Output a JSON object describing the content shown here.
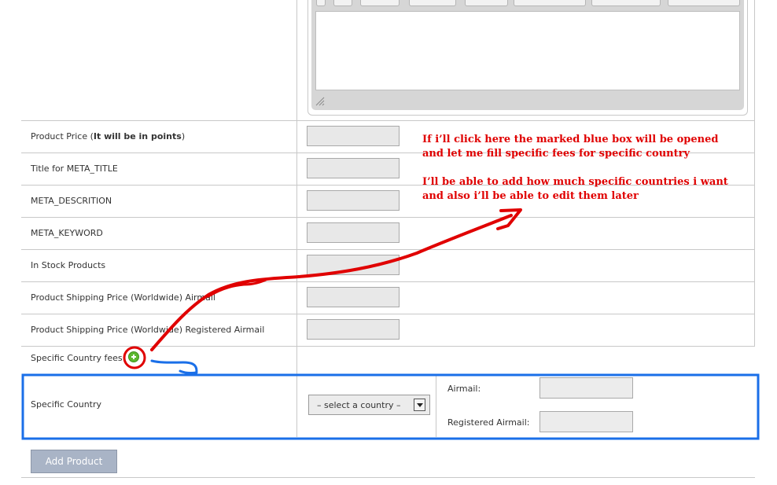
{
  "form": {
    "rows": [
      {
        "id": "price",
        "label_prefix": "Product Price (",
        "label_bold": "It will be in points",
        "label_suffix": ")"
      },
      {
        "id": "meta_title",
        "label": "Title for META_TITLE"
      },
      {
        "id": "meta_desc",
        "label": "META_DESCRITION"
      },
      {
        "id": "meta_keyword",
        "label": "META_KEYWORD"
      },
      {
        "id": "stock",
        "label": "In Stock Products"
      },
      {
        "id": "ship_airmail",
        "label": "Product Shipping Price (Worldwide) Airmail"
      },
      {
        "id": "ship_registered",
        "label": "Product Shipping Price (Worldwide) Registered Airmail"
      },
      {
        "id": "specific_fees",
        "label": "Specific Country fees"
      }
    ],
    "specific_country": {
      "label": "Specific Country",
      "select_value": "– select a country –",
      "airmail_label": "Airmail:",
      "registered_label": "Registered Airmail:"
    },
    "submit_label": "Add Product"
  },
  "annotation": {
    "line1": "If i’ll click here the marked blue box will be opened",
    "line2": "and let me fill specific fees for specific country",
    "line3": "I’ll be able to add how much specific countries i want",
    "line4": "and also i’ll be able to edit them later",
    "colors": {
      "red": "#e00000",
      "blue": "#1a6fe8"
    }
  },
  "icons": {
    "add": "plus-circle-icon",
    "resize": "resize-grip-icon"
  }
}
